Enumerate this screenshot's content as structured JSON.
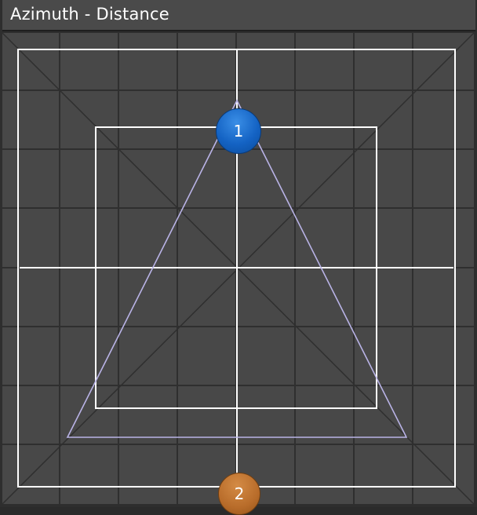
{
  "window": {
    "title": "Azimuth - Distance"
  },
  "speakers": [
    {
      "label": "1",
      "color": "#1463c4"
    },
    {
      "label": "2",
      "color": "#b86c2a"
    }
  ],
  "colors": {
    "background": "#484848",
    "grid": "#2f2f2f",
    "frame": "#ffffff",
    "triangle": "#b9b3e6"
  }
}
